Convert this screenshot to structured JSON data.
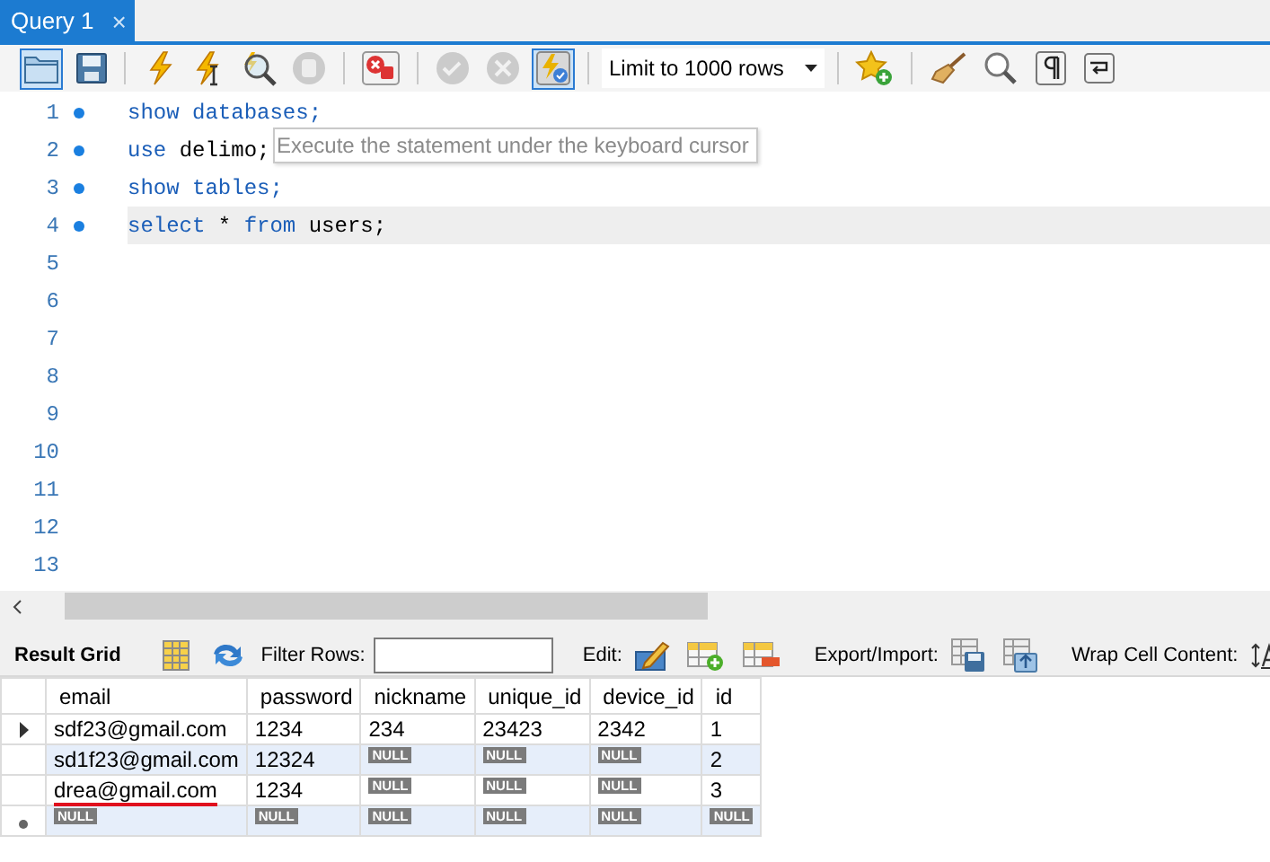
{
  "tab": {
    "title": "Query 1",
    "close": "×",
    "selected": true
  },
  "toolbar": [
    {
      "kind": "button",
      "pressed": true,
      "disabled": false
    },
    {
      "kind": "button",
      "pressed": false,
      "disabled": false
    },
    {
      "kind": "separator"
    },
    {
      "kind": "button",
      "pressed": false,
      "disabled": false
    },
    {
      "kind": "button",
      "pressed": false,
      "disabled": false
    },
    {
      "kind": "button",
      "pressed": false,
      "disabled": false
    },
    {
      "kind": "button",
      "pressed": false,
      "disabled": true
    },
    {
      "kind": "separator"
    },
    {
      "kind": "button",
      "pressed": false,
      "disabled": false
    },
    {
      "kind": "separator"
    },
    {
      "kind": "button",
      "pressed": false,
      "disabled": true
    },
    {
      "kind": "button",
      "pressed": false,
      "disabled": true
    },
    {
      "kind": "button",
      "pressed": true,
      "disabled": false
    },
    {
      "kind": "separator"
    },
    {
      "kind": "dropdown",
      "value": "Limit to 1000 rows"
    },
    {
      "kind": "separator"
    },
    {
      "kind": "button",
      "pressed": false,
      "disabled": false
    },
    {
      "kind": "separator"
    },
    {
      "kind": "button",
      "pressed": false,
      "disabled": false
    },
    {
      "kind": "button",
      "pressed": false,
      "disabled": false
    },
    {
      "kind": "button",
      "pressed": false,
      "disabled": false
    },
    {
      "kind": "button",
      "pressed": false,
      "disabled": false
    }
  ],
  "editor": {
    "lines": [
      {
        "number": "1",
        "statement": true,
        "current": false,
        "tokens": [
          {
            "text": "show",
            "keyword": true
          },
          {
            "text": "databases;",
            "keyword": true
          }
        ]
      },
      {
        "number": "2",
        "statement": true,
        "current": false,
        "tokens": [
          {
            "text": "use",
            "keyword": true
          },
          {
            "text": "delimo;",
            "keyword": false
          }
        ]
      },
      {
        "number": "3",
        "statement": true,
        "current": false,
        "tokens": [
          {
            "text": "show",
            "keyword": true
          },
          {
            "text": "tables;",
            "keyword": true
          }
        ]
      },
      {
        "number": "4",
        "statement": true,
        "current": true,
        "tokens": [
          {
            "text": "select",
            "keyword": true
          },
          {
            "text": "*",
            "keyword": false
          },
          {
            "text": "from",
            "keyword": true
          },
          {
            "text": "users;",
            "keyword": false
          }
        ]
      },
      {
        "number": "5",
        "statement": false,
        "current": false
      },
      {
        "number": "6",
        "statement": false,
        "current": false
      },
      {
        "number": "7",
        "statement": false,
        "current": false
      },
      {
        "number": "8",
        "statement": false,
        "current": false
      },
      {
        "number": "9",
        "statement": false,
        "current": false
      },
      {
        "number": "10",
        "statement": false,
        "current": false
      },
      {
        "number": "11",
        "statement": false,
        "current": false
      },
      {
        "number": "12",
        "statement": false,
        "current": false
      },
      {
        "number": "13",
        "statement": false,
        "current": false
      }
    ],
    "tooltip": "Execute the statement under the keyboard cursor"
  },
  "results_toolbar": [
    {
      "kind": "tab",
      "label": "Result Grid",
      "selected": true
    },
    {
      "kind": "separator"
    },
    {
      "kind": "button"
    },
    {
      "kind": "button"
    },
    {
      "kind": "label",
      "text": "Filter Rows:"
    },
    {
      "kind": "field"
    },
    {
      "kind": "separator"
    },
    {
      "kind": "label",
      "text": "Edit:"
    },
    {
      "kind": "button"
    },
    {
      "kind": "button"
    },
    {
      "kind": "button"
    },
    {
      "kind": "separator"
    },
    {
      "kind": "label",
      "text": "Export/Import:"
    },
    {
      "kind": "button"
    },
    {
      "kind": "button"
    },
    {
      "kind": "separator"
    },
    {
      "kind": "label",
      "text": "Wrap Cell Content:"
    },
    {
      "kind": "button"
    }
  ],
  "grid": {
    "columns": [
      "email",
      "password",
      "nickname",
      "unique_id",
      "device_id",
      "id"
    ],
    "rows": [
      {
        "current": true,
        "new_row": false,
        "cells": [
          {
            "text": "sdf23@gmail.com",
            "kind": "value",
            "underline": false
          },
          {
            "text": "1234",
            "kind": "value",
            "underline": false
          },
          {
            "text": "234",
            "kind": "value",
            "underline": false
          },
          {
            "text": "23423",
            "kind": "value",
            "underline": false
          },
          {
            "text": "2342",
            "kind": "value",
            "underline": false
          },
          {
            "text": "1",
            "kind": "value",
            "underline": false
          }
        ]
      },
      {
        "current": false,
        "new_row": false,
        "cells": [
          {
            "text": "sd1f23@gmail.com",
            "kind": "value",
            "underline": false
          },
          {
            "text": "12324",
            "kind": "value",
            "underline": false
          },
          {
            "text": "NULL",
            "kind": "null"
          },
          {
            "text": "NULL",
            "kind": "null"
          },
          {
            "text": "NULL",
            "kind": "null"
          },
          {
            "text": "2",
            "kind": "value",
            "underline": false
          }
        ]
      },
      {
        "current": false,
        "new_row": false,
        "cells": [
          {
            "text": "drea@gmail.com",
            "kind": "value",
            "underline": true
          },
          {
            "text": "1234",
            "kind": "value",
            "underline": false
          },
          {
            "text": "NULL",
            "kind": "null"
          },
          {
            "text": "NULL",
            "kind": "null"
          },
          {
            "text": "NULL",
            "kind": "null"
          },
          {
            "text": "3",
            "kind": "value",
            "underline": false
          }
        ]
      },
      {
        "current": false,
        "new_row": true,
        "cells": [
          {
            "text": "NULL",
            "kind": "null"
          },
          {
            "text": "NULL",
            "kind": "null"
          },
          {
            "text": "NULL",
            "kind": "null"
          },
          {
            "text": "NULL",
            "kind": "null"
          },
          {
            "text": "NULL",
            "kind": "null"
          },
          {
            "text": "NULL",
            "kind": "null"
          }
        ]
      }
    ]
  }
}
